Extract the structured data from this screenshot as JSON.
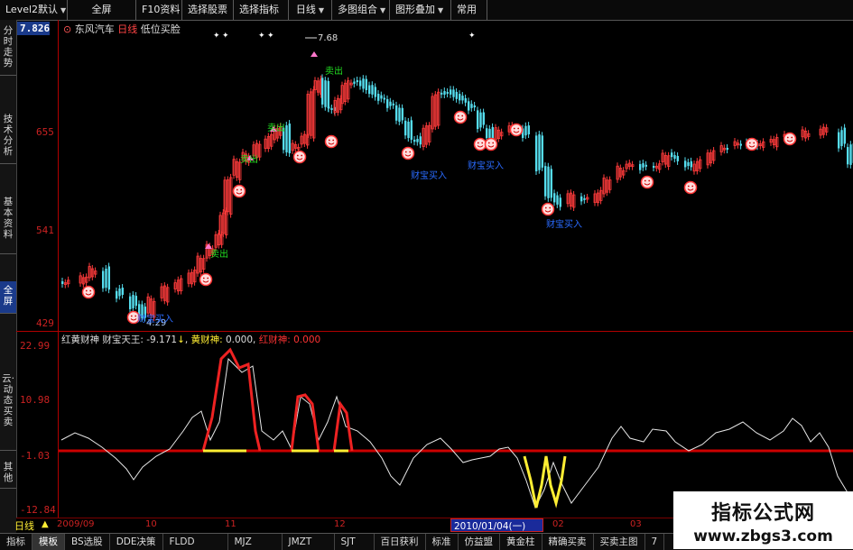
{
  "toolbar": {
    "items": [
      "Level2默认",
      "全屏",
      "F10资料",
      "选择股票",
      "选择指标",
      "日线",
      "多图组合",
      "图形叠加",
      "常用"
    ]
  },
  "left_tabs": [
    "分时走势",
    "技术分析",
    "基本资料",
    "全屏",
    "云·动态买卖",
    "其他"
  ],
  "price_axis": {
    "top_value": "7.826",
    "labels": [
      "655",
      "541",
      "429"
    ]
  },
  "main_header": {
    "stock": "东风汽车",
    "period": "日线",
    "formula": "低位买脸"
  },
  "annotations": {
    "high": "7.68",
    "low": "4.29",
    "sell_label": "卖出",
    "buy_label": "财宝买入"
  },
  "indicator": {
    "name": "红黄财神",
    "caishen_label": "财宝天王:",
    "caishen_value": "-9.171",
    "yellow_label": "黄财神:",
    "yellow_value": "0.000",
    "red_label": "红财神:",
    "red_value": "0.000",
    "axis_labels": [
      "22.99",
      "10.98",
      "-1.03",
      "-12.84"
    ]
  },
  "datebar": {
    "period": "日线",
    "labels": [
      "2009/09",
      "10",
      "11",
      "12",
      "02",
      "03"
    ],
    "cursor_date": "2010/01/04(一)"
  },
  "bottom_tabs": [
    "指标",
    "模板",
    "BS选股",
    "DDE决策",
    "FLDD",
    "MJZ",
    "JMZT",
    "SJT",
    "百日获利",
    "标准",
    "仿益盟",
    "黄金柱",
    "精确买卖",
    "买卖主图",
    "7"
  ],
  "watermark": {
    "title": "指标公式网",
    "url": "www.zbgs3.com"
  },
  "colors": {
    "up": "#ff3b3b",
    "down": "#55ddee",
    "axis_red": "#cc0000",
    "yellow": "#ffee33",
    "green_text": "#22dd22",
    "blue_text": "#2a6bff"
  }
}
